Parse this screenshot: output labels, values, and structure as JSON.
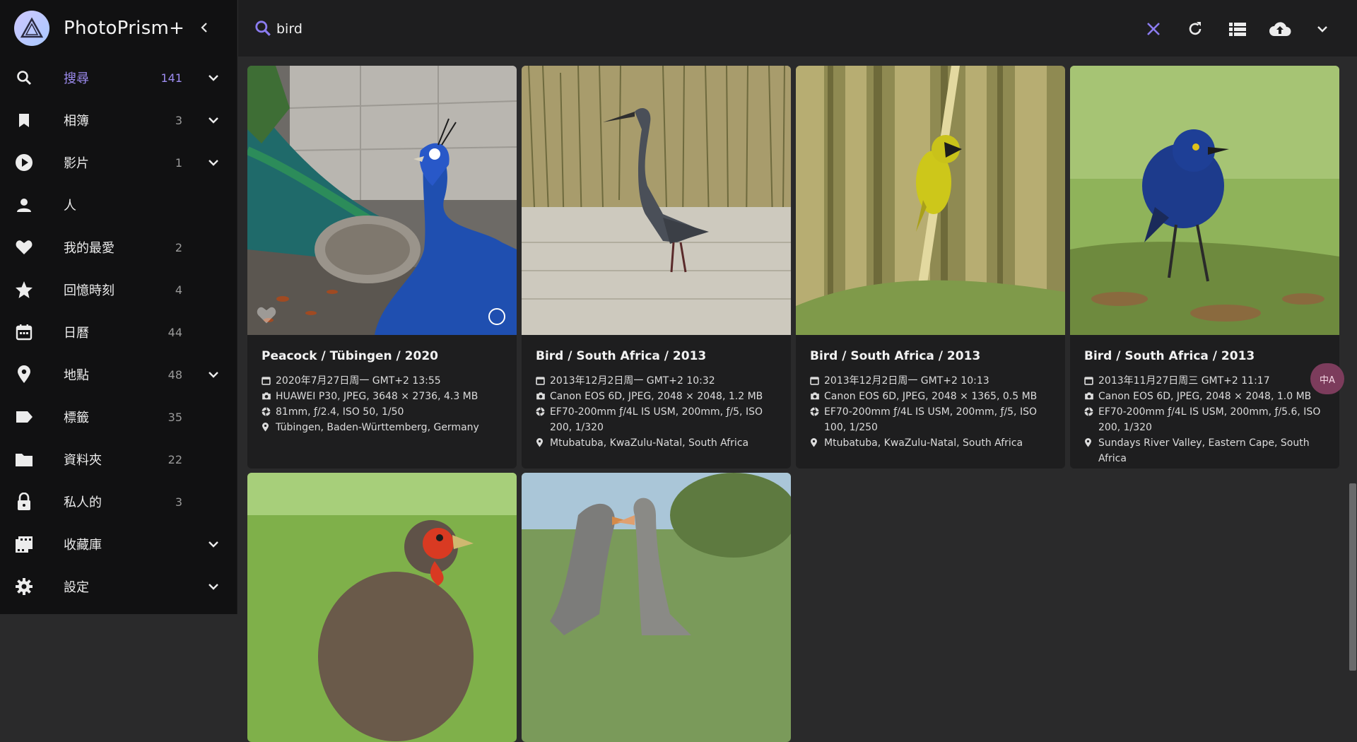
{
  "app": {
    "title": "PhotoPrism+"
  },
  "search": {
    "value": "bird",
    "placeholder": ""
  },
  "nav": [
    {
      "label": "搜尋",
      "count": "141",
      "icon": "search-icon",
      "chevron": true,
      "active": true
    },
    {
      "label": "相簿",
      "count": "3",
      "icon": "bookmark-icon",
      "chevron": true
    },
    {
      "label": "影片",
      "count": "1",
      "icon": "play-circle-icon",
      "chevron": true
    },
    {
      "label": "人",
      "count": "",
      "icon": "person-icon",
      "chevron": false
    },
    {
      "label": "我的最愛",
      "count": "2",
      "icon": "heart-icon",
      "chevron": false
    },
    {
      "label": "回憶時刻",
      "count": "4",
      "icon": "star-icon",
      "chevron": false
    },
    {
      "label": "日曆",
      "count": "44",
      "icon": "calendar-icon",
      "chevron": false
    },
    {
      "label": "地點",
      "count": "48",
      "icon": "map-pin-icon",
      "chevron": true
    },
    {
      "label": "標籤",
      "count": "35",
      "icon": "label-tag-icon",
      "chevron": false
    },
    {
      "label": "資料夾",
      "count": "22",
      "icon": "folder-icon",
      "chevron": false
    },
    {
      "label": "私人的",
      "count": "3",
      "icon": "lock-icon",
      "chevron": false
    },
    {
      "label": "收藏庫",
      "count": "",
      "icon": "film-library-icon",
      "chevron": true
    },
    {
      "label": "設定",
      "count": "",
      "icon": "gear-icon",
      "chevron": true
    }
  ],
  "toolbar": {
    "icons": [
      "close-icon",
      "refresh-icon",
      "list-view-icon",
      "upload-cloud-icon",
      "chevron-down-icon"
    ],
    "accent": "#8b7cf0"
  },
  "photos": [
    {
      "title": "Peacock / Tübingen / 2020",
      "date": "2020年7月27日周一 GMT+2 13:55",
      "camera": "HUAWEI P30, JPEG, 3648 × 2736, 4.3 MB",
      "lens": "81mm, ƒ/2.4, ISO 50, 1/50",
      "location": "Tübingen, Baden-Württemberg, Germany"
    },
    {
      "title": "Bird / South Africa / 2013",
      "date": "2013年12月2日周一 GMT+2 10:32",
      "camera": "Canon EOS 6D, JPEG, 2048 × 2048, 1.2 MB",
      "lens": "EF70-200mm ƒ/4L IS USM, 200mm, ƒ/5, ISO 200, 1/320",
      "location": "Mtubatuba, KwaZulu-Natal, South Africa"
    },
    {
      "title": "Bird / South Africa / 2013",
      "date": "2013年12月2日周一 GMT+2 10:13",
      "camera": "Canon EOS 6D, JPEG, 2048 × 1365, 0.5 MB",
      "lens": "EF70-200mm ƒ/4L IS USM, 200mm, ƒ/5, ISO 100, 1/250",
      "location": "Mtubatuba, KwaZulu-Natal, South Africa"
    },
    {
      "title": "Bird / South Africa / 2013",
      "date": "2013年11月27日周三 GMT+2 11:17",
      "camera": "Canon EOS 6D, JPEG, 2048 × 2048, 1.0 MB",
      "lens": "EF70-200mm ƒ/4L IS USM, 200mm, ƒ/5.6, ISO 200, 1/320",
      "location": "Sundays River Valley, Eastern Cape, South Africa"
    }
  ],
  "translate_badge": "中A"
}
